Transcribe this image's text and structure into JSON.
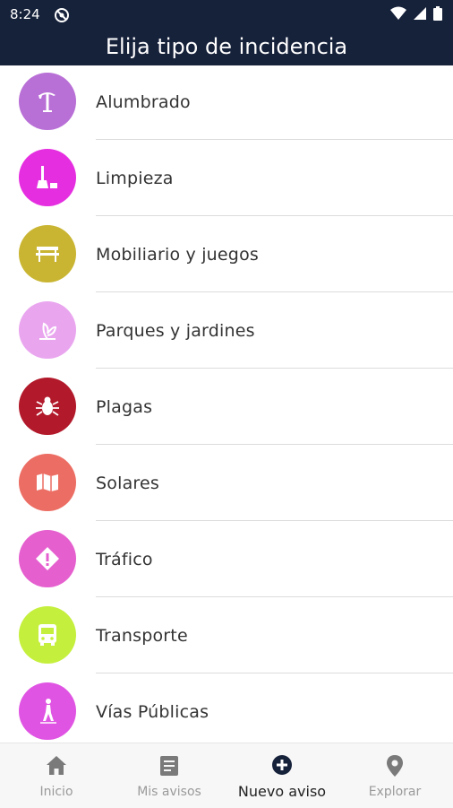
{
  "status_bar": {
    "time": "8:24"
  },
  "header": {
    "title": "Elija tipo de incidencia"
  },
  "categories": [
    {
      "label": "Alumbrado",
      "icon": "street-lamp-icon",
      "color": "#b86fd6"
    },
    {
      "label": "Limpieza",
      "icon": "broom-icon",
      "color": "#e52ee0"
    },
    {
      "label": "Mobiliario y juegos",
      "icon": "bench-icon",
      "color": "#c9b532"
    },
    {
      "label": "Parques y jardines",
      "icon": "plant-icon",
      "color": "#e9a6ef"
    },
    {
      "label": "Plagas",
      "icon": "bug-icon",
      "color": "#b2192a"
    },
    {
      "label": "Solares",
      "icon": "map-icon",
      "color": "#ec6d63"
    },
    {
      "label": "Tráfico",
      "icon": "traffic-sign-icon",
      "color": "#e55fcf"
    },
    {
      "label": "Transporte",
      "icon": "bus-icon",
      "color": "#c5ef3d"
    },
    {
      "label": "Vías Públicas",
      "icon": "pedestrian-icon",
      "color": "#e054e3"
    }
  ],
  "bottom_nav": {
    "items": [
      {
        "label": "Inicio",
        "icon": "home-icon"
      },
      {
        "label": "Mis avisos",
        "icon": "document-icon"
      },
      {
        "label": "Nuevo aviso",
        "icon": "add-circle-icon",
        "active": true
      },
      {
        "label": "Explorar",
        "icon": "location-pin-icon"
      }
    ]
  }
}
